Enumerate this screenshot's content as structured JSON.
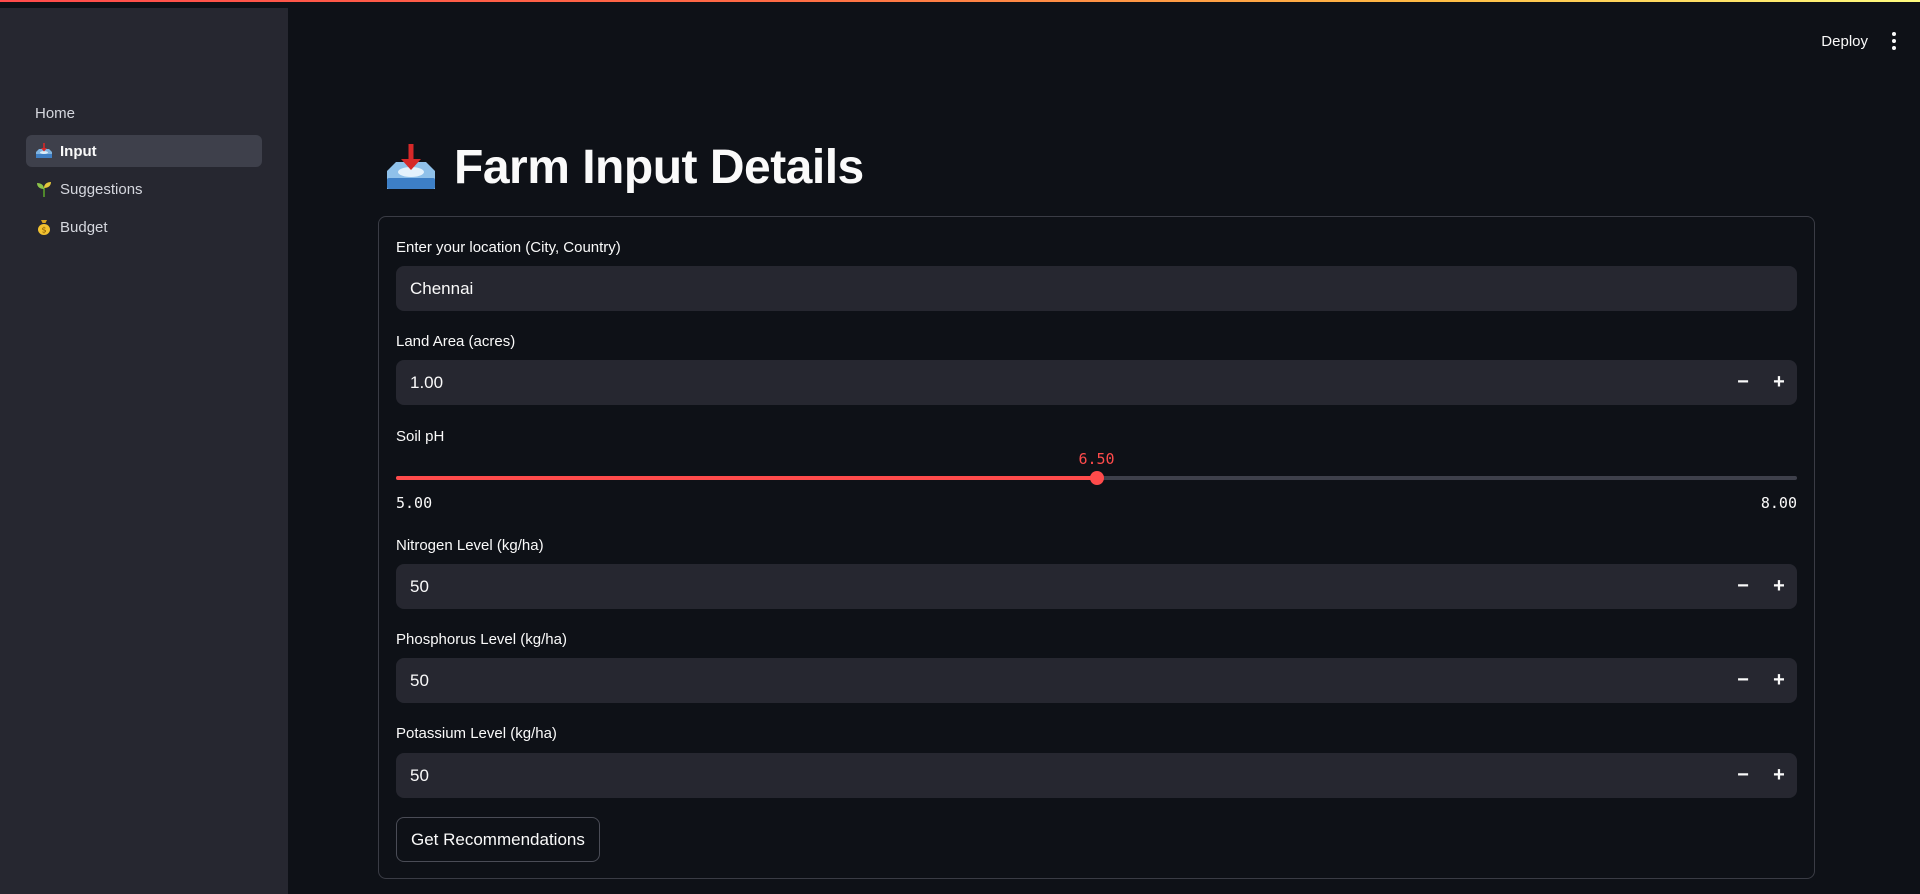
{
  "sidebar": {
    "items": [
      {
        "label": "Home",
        "icon": "",
        "active": false
      },
      {
        "label": "Input",
        "icon": "inbox-tray-icon",
        "active": true
      },
      {
        "label": "Suggestions",
        "icon": "seedling-icon",
        "active": false
      },
      {
        "label": "Budget",
        "icon": "money-bag-icon",
        "active": false
      }
    ]
  },
  "toolbar": {
    "deploy_label": "Deploy",
    "menu_icon": "kebab-menu-icon"
  },
  "page": {
    "title": "Farm Input Details",
    "title_icon": "inbox-tray-icon"
  },
  "form": {
    "location": {
      "label": "Enter your location (City, Country)",
      "value": "Chennai"
    },
    "land_area": {
      "label": "Land Area (acres)",
      "value": "1.00"
    },
    "soil_ph": {
      "label": "Soil pH",
      "value": "6.50",
      "min": "5.00",
      "max": "8.00",
      "value_num": 6.5,
      "min_num": 5,
      "max_num": 8
    },
    "nitrogen": {
      "label": "Nitrogen Level (kg/ha)",
      "value": "50"
    },
    "phosphorus": {
      "label": "Phosphorus Level (kg/ha)",
      "value": "50"
    },
    "potassium": {
      "label": "Potassium Level (kg/ha)",
      "value": "50"
    },
    "step_minus": "−",
    "step_plus": "+",
    "submit_label": "Get Recommendations"
  },
  "colors": {
    "accent": "#ff4b4b",
    "background": "#0e1117",
    "sidebar": "#262730",
    "input": "#262730"
  }
}
